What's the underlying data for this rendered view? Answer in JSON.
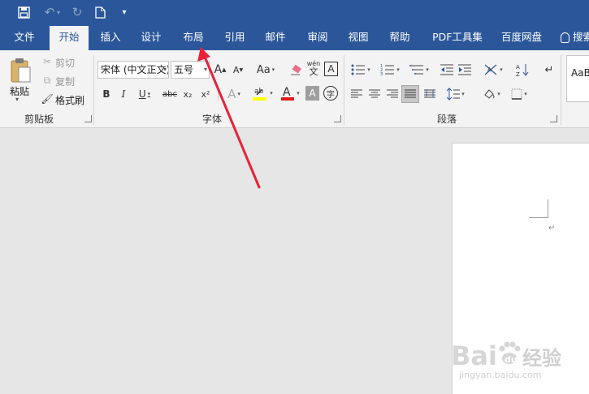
{
  "qat": {
    "save_icon": "save-icon",
    "undo_icon": "undo-icon",
    "redo_icon": "redo-icon",
    "new_icon": "new-document-icon",
    "customize_icon": "customize-qat-icon"
  },
  "tabs": [
    {
      "label": "文件"
    },
    {
      "label": "开始"
    },
    {
      "label": "插入"
    },
    {
      "label": "设计"
    },
    {
      "label": "布局"
    },
    {
      "label": "引用"
    },
    {
      "label": "邮件"
    },
    {
      "label": "审阅"
    },
    {
      "label": "视图"
    },
    {
      "label": "帮助"
    },
    {
      "label": "PDF工具集"
    },
    {
      "label": "百度网盘"
    },
    {
      "label": "搜索"
    }
  ],
  "clipboard": {
    "paste_label": "粘贴",
    "cut_label": "剪切",
    "copy_label": "复制",
    "format_painter_label": "格式刷",
    "group_label": "剪贴板"
  },
  "font": {
    "font_name": "宋体 (中文正文)",
    "font_size": "五号",
    "change_case": "Aa",
    "group_label": "字体",
    "bold": "B",
    "italic": "I",
    "underline": "U",
    "strike": "abc",
    "subscript": "x₂",
    "superscript": "x²",
    "pinyin_top": "wén",
    "pinyin_bottom": "文",
    "char_border": "A",
    "char_shade": "A",
    "enclose": "字"
  },
  "paragraph": {
    "group_label": "段落"
  },
  "styles": {
    "preview": "AaB"
  },
  "document": {
    "paragraph_mark": "↵"
  },
  "watermark": {
    "brand": "Bai",
    "brand2": "du",
    "jingyan": "经验",
    "url": "jingyan.baidu.com"
  },
  "colors": {
    "accent": "#2b579a",
    "arrow": "#e8223a",
    "highlight": "#ffff00",
    "font_color": "#e01b1b"
  }
}
